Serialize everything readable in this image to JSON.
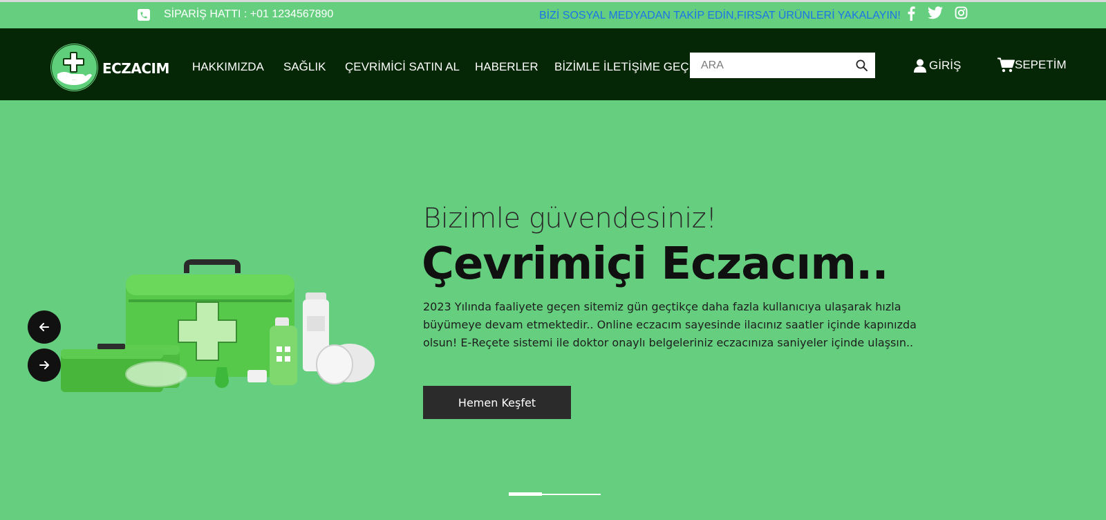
{
  "topbar": {
    "phone_label": "SİPARİŞ HATTI : +01 1234567890",
    "social_text": "BİZİ SOSYAL MEDYADAN TAKİP EDİN,FIRSAT ÜRÜNLERİ YAKALAYIN!",
    "social_icons": [
      "facebook-icon",
      "twitter-icon",
      "instagram-icon"
    ]
  },
  "header": {
    "logo_text": "ECZACIM",
    "nav": [
      "HAKKIMIZDA",
      "SAĞLIK",
      "ÇEVRİMİCİ SATIN AL",
      "HABERLER",
      "BİZİMLE İLETİŞİME GEÇ"
    ],
    "search_placeholder": "ARA",
    "login_label": "GİRİŞ",
    "cart_label": "SEPETİM"
  },
  "hero": {
    "subtitle": "Bizimle güvendesiniz!",
    "title": "Çevrimiçi Eczacım..",
    "description": "2023 Yılında faaliyete geçen sitemiz gün geçtikçe daha fazla kullanıcıya ulaşarak hızla büyümeye devam etmektedir.. Online eczacım sayesinde ilacınız saatler içinde kapınızda olsun! E-Reçete sistemi ile doktor onaylı belgeleriniz eczacınıza saniyeler içinde ulaşsın..",
    "cta_label": "Hemen Keşfet",
    "slide_count": 2,
    "active_slide": 1
  },
  "colors": {
    "brand_green": "#66cf7f",
    "nav_dark": "#052705",
    "social_blue": "#1a74e8",
    "cta_dark": "#2b2b2b"
  }
}
